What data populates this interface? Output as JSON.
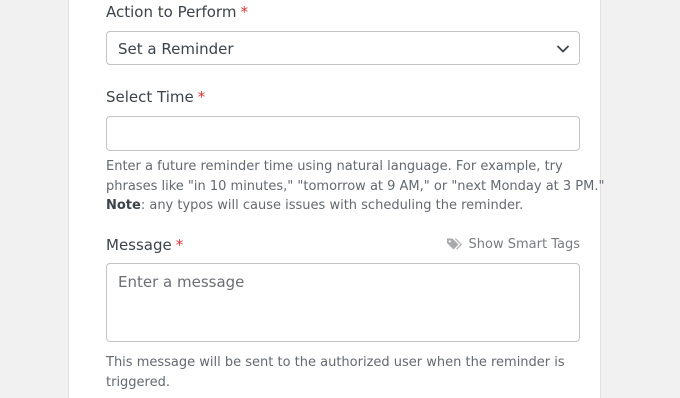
{
  "action_field": {
    "label": "Action to Perform",
    "required_mark": "*",
    "selected_value": "Set a Reminder",
    "dropdown_icon": "chevron-down-icon"
  },
  "time_field": {
    "label": "Select Time",
    "required_mark": "*",
    "value": "",
    "help_line_1": "Enter a future reminder time using natural language. For example, try",
    "help_line_2": "phrases like \"in 10 minutes,\" \"tomorrow at 9 AM,\" or \"next Monday at 3 PM.\"",
    "note_label": "Note",
    "note_text": ": any typos will cause issues with scheduling the reminder."
  },
  "message_field": {
    "label": "Message",
    "required_mark": "*",
    "smart_tags_label": "Show Smart Tags",
    "smart_tags_icon": "tags-icon",
    "placeholder": "Enter a message",
    "value": "",
    "help_line_1": "This message will be sent to the authorized user when the reminder is",
    "help_line_2": "triggered."
  },
  "colors": {
    "background": "#f1f1f1",
    "panel": "#ffffff",
    "required": "#d63638",
    "label_text": "#3c434a",
    "help_text": "#646970",
    "border": "#c3c4c7"
  }
}
